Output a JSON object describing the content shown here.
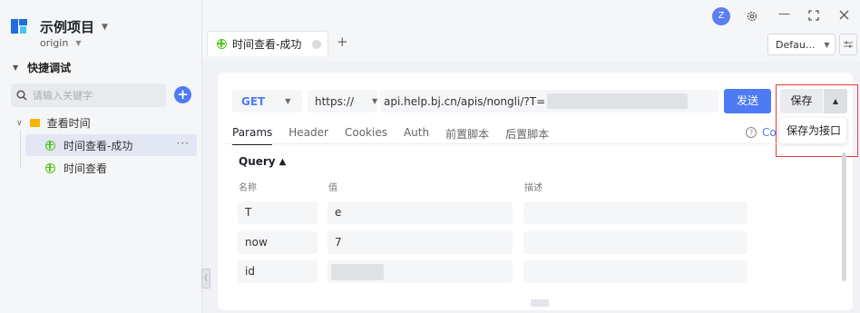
{
  "sidebar": {
    "project_name": "示例项目",
    "branch": "origin",
    "section_title": "快捷调试",
    "search_placeholder": "请输入关键字",
    "folder_name": "查看时间",
    "items": [
      {
        "label": "时间查看-成功",
        "active": true
      },
      {
        "label": "时间查看",
        "active": false
      }
    ]
  },
  "header": {
    "avatar_letter": "Z",
    "tab_label": "时间查看-成功",
    "environment": "Defau..."
  },
  "request": {
    "method": "GET",
    "protocol": "https://",
    "url": "api.help.bj.cn/apis/nongli/?T=",
    "send_label": "发送",
    "save_label": "保存",
    "save_menu_item": "保存为接口",
    "code_link": "Co"
  },
  "subtabs": [
    "Params",
    "Header",
    "Cookies",
    "Auth",
    "前置脚本",
    "后置脚本"
  ],
  "params": {
    "title": "Query",
    "columns": {
      "name": "名称",
      "value": "值",
      "desc": "描述"
    },
    "rows": [
      {
        "name": "T",
        "value": "e",
        "desc": ""
      },
      {
        "name": "now",
        "value": "7",
        "desc": ""
      },
      {
        "name": "id",
        "value": "",
        "desc": ""
      }
    ]
  },
  "colors": {
    "accent": "#4d7bf3",
    "highlight": "#e8383d",
    "folder": "#f7b500",
    "api_icon": "#52c41a"
  }
}
